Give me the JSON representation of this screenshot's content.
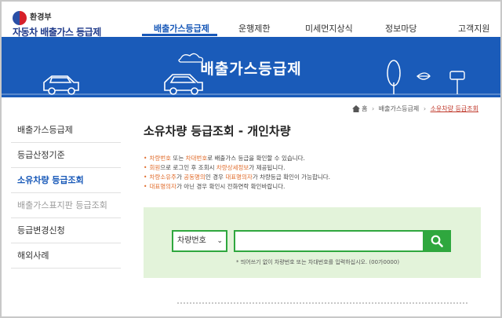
{
  "logo": {
    "ministry": "환경부",
    "site_name": "자동차 배출가스 등급제"
  },
  "gnb": {
    "items": [
      {
        "label": "배출가스등급제",
        "active": true
      },
      {
        "label": "운행제한",
        "active": false
      },
      {
        "label": "미세먼지상식",
        "active": false
      },
      {
        "label": "정보마당",
        "active": false
      },
      {
        "label": "고객지원",
        "active": false
      }
    ]
  },
  "banner": {
    "title": "배출가스등급제"
  },
  "breadcrumb": {
    "home": "홈",
    "level1": "배출가스등급제",
    "current": "소유차량 등급조회"
  },
  "lnb": {
    "items": [
      {
        "label": "배출가스등급제",
        "state": "normal"
      },
      {
        "label": "등급산정기준",
        "state": "normal"
      },
      {
        "label": "소유차량 등급조회",
        "state": "active"
      },
      {
        "label": "배출가스표지판 등급조회",
        "state": "disabled"
      },
      {
        "label": "등급변경신청",
        "state": "normal"
      },
      {
        "label": "해외사례",
        "state": "normal"
      }
    ]
  },
  "content": {
    "title": "소유차량 등급조회 - 개인차량",
    "notes": [
      {
        "parts": [
          {
            "t": "차량번호",
            "hl": true
          },
          {
            "t": " 또는 ",
            "hl": false
          },
          {
            "t": "차대번호",
            "hl": true
          },
          {
            "t": "로 배출가스 등급을 확인할 수 있습니다.",
            "hl": false
          }
        ]
      },
      {
        "parts": [
          {
            "t": "회원",
            "hl": true
          },
          {
            "t": "으로 로그인 후 조회시 ",
            "hl": false
          },
          {
            "t": "차량상세정보",
            "hl": true
          },
          {
            "t": "가 제공됩니다.",
            "hl": false
          }
        ]
      },
      {
        "parts": [
          {
            "t": "차량소유주",
            "hl": true
          },
          {
            "t": "가 ",
            "hl": false
          },
          {
            "t": "공동명의",
            "hl": true
          },
          {
            "t": "인 경우 ",
            "hl": false
          },
          {
            "t": "대표명의자",
            "hl": true
          },
          {
            "t": "가 차량등급 확인이 가능합니다.",
            "hl": false
          }
        ]
      },
      {
        "parts": [
          {
            "t": "대표명의자",
            "hl": true
          },
          {
            "t": "가 아닌 경우 확인시 전화연락 확인바랍니다.",
            "hl": false
          }
        ]
      }
    ]
  },
  "search": {
    "select_value": "차량번호",
    "input_value": "",
    "hint": "* 띄어쓰기 없이 차량번호 또는 차대번호를 입력하십시오. (00가0000)"
  },
  "colors": {
    "brand_blue": "#1a5bb9",
    "active_blue": "#1758b8",
    "accent_green": "#2fa73e",
    "search_bg": "#e3f3da",
    "highlight": "#e06b2a"
  }
}
